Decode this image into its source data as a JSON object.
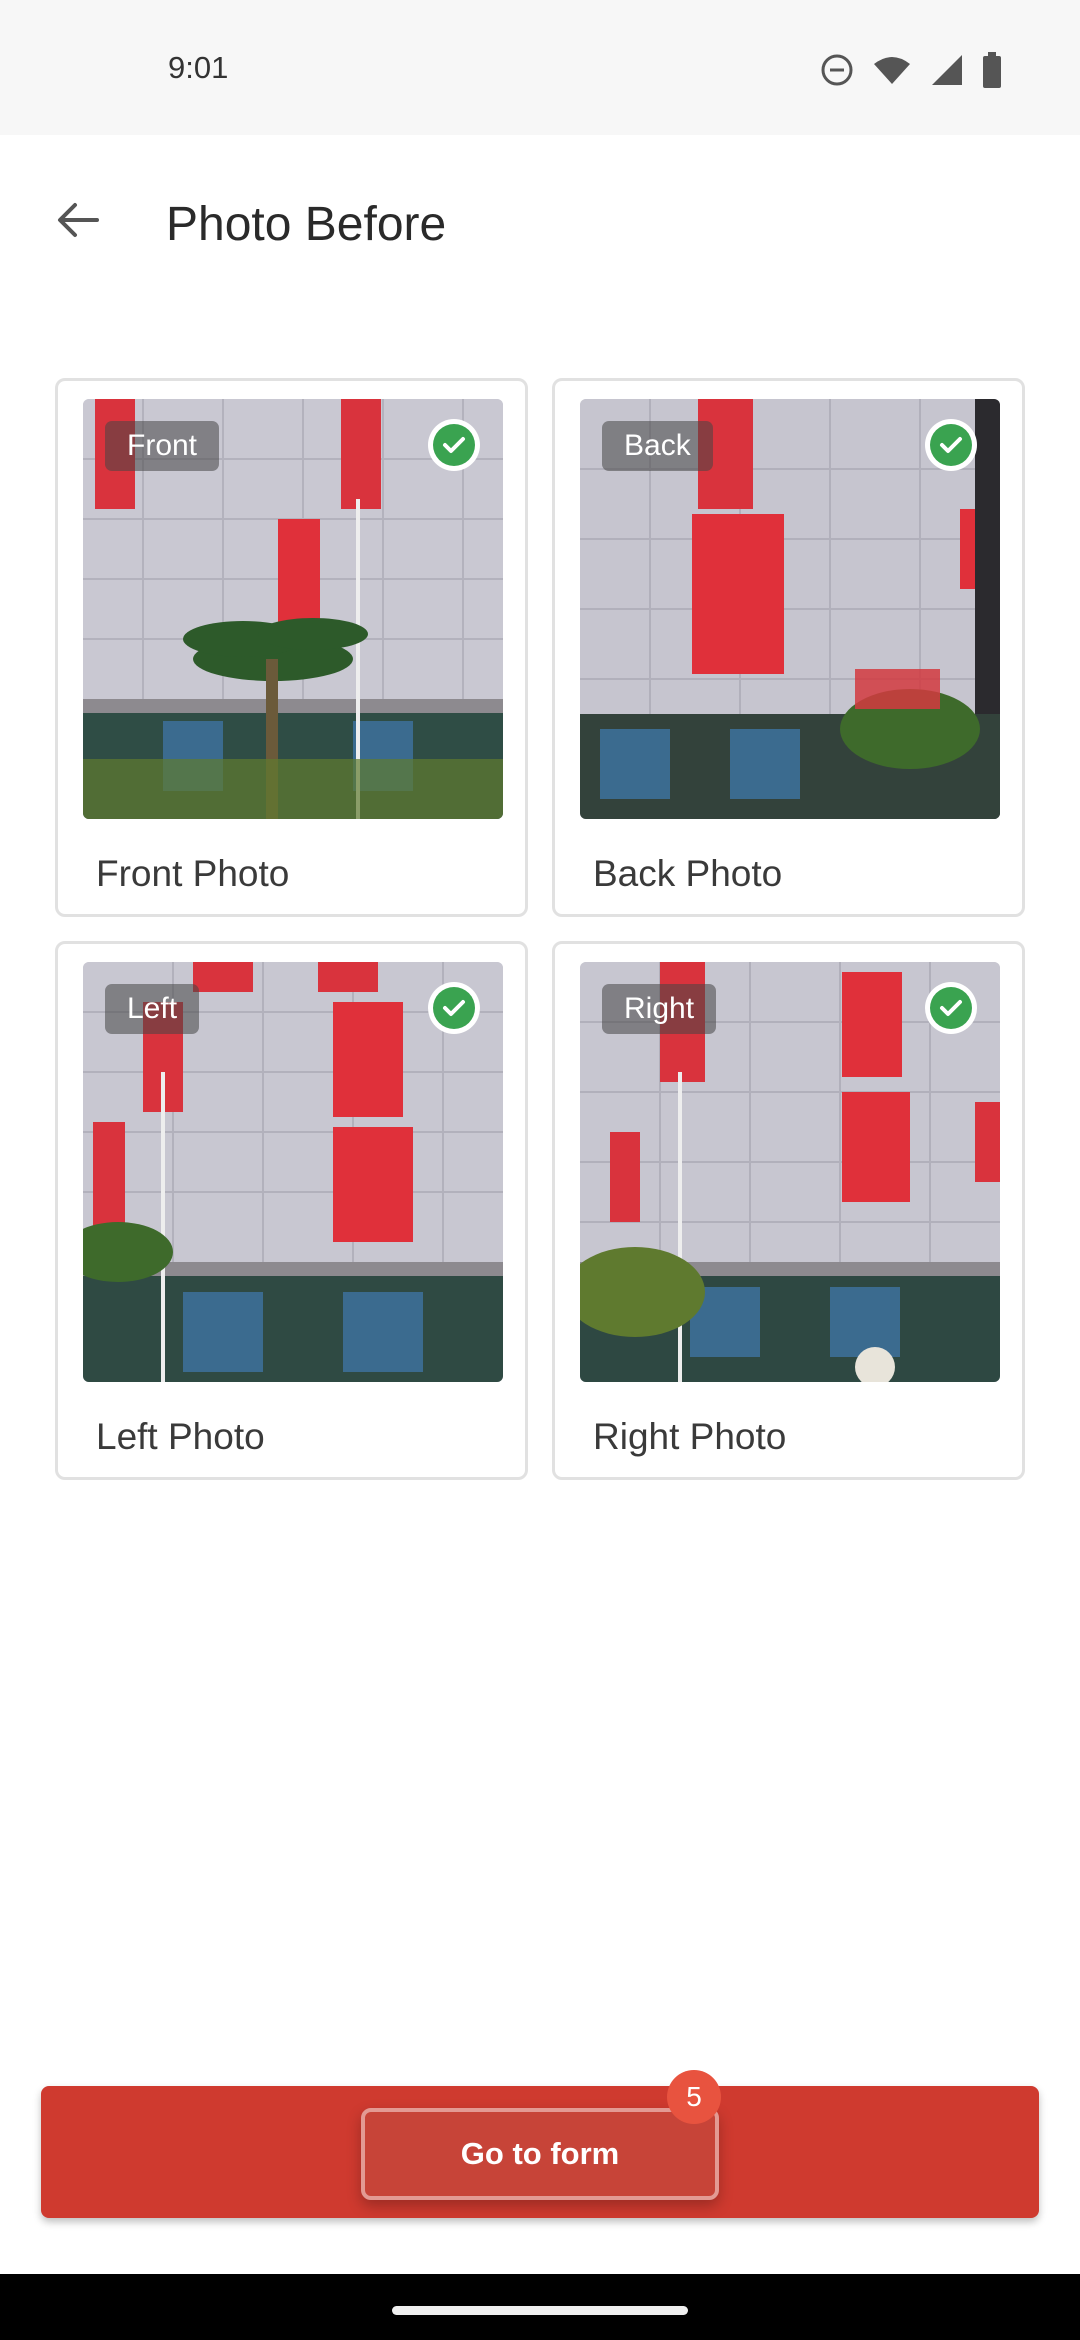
{
  "status_bar": {
    "time": "9:01",
    "icons": [
      "do-not-disturb-icon",
      "wifi-icon",
      "signal-icon",
      "battery-icon"
    ]
  },
  "app_bar": {
    "title": "Photo Before",
    "back_icon": "arrow-left-icon"
  },
  "photos": [
    {
      "tag": "Front",
      "label": "Front Photo",
      "checked": true
    },
    {
      "tag": "Back",
      "label": "Back Photo",
      "checked": true
    },
    {
      "tag": "Left",
      "label": "Left Photo",
      "checked": true
    },
    {
      "tag": "Right",
      "label": "Right Photo",
      "checked": true
    }
  ],
  "bottom": {
    "button_label": "Go to form",
    "badge_count": "5"
  },
  "colors": {
    "accent_red": "#cf3a2f",
    "check_green": "#3aa350",
    "badge_red": "#e8533f"
  }
}
